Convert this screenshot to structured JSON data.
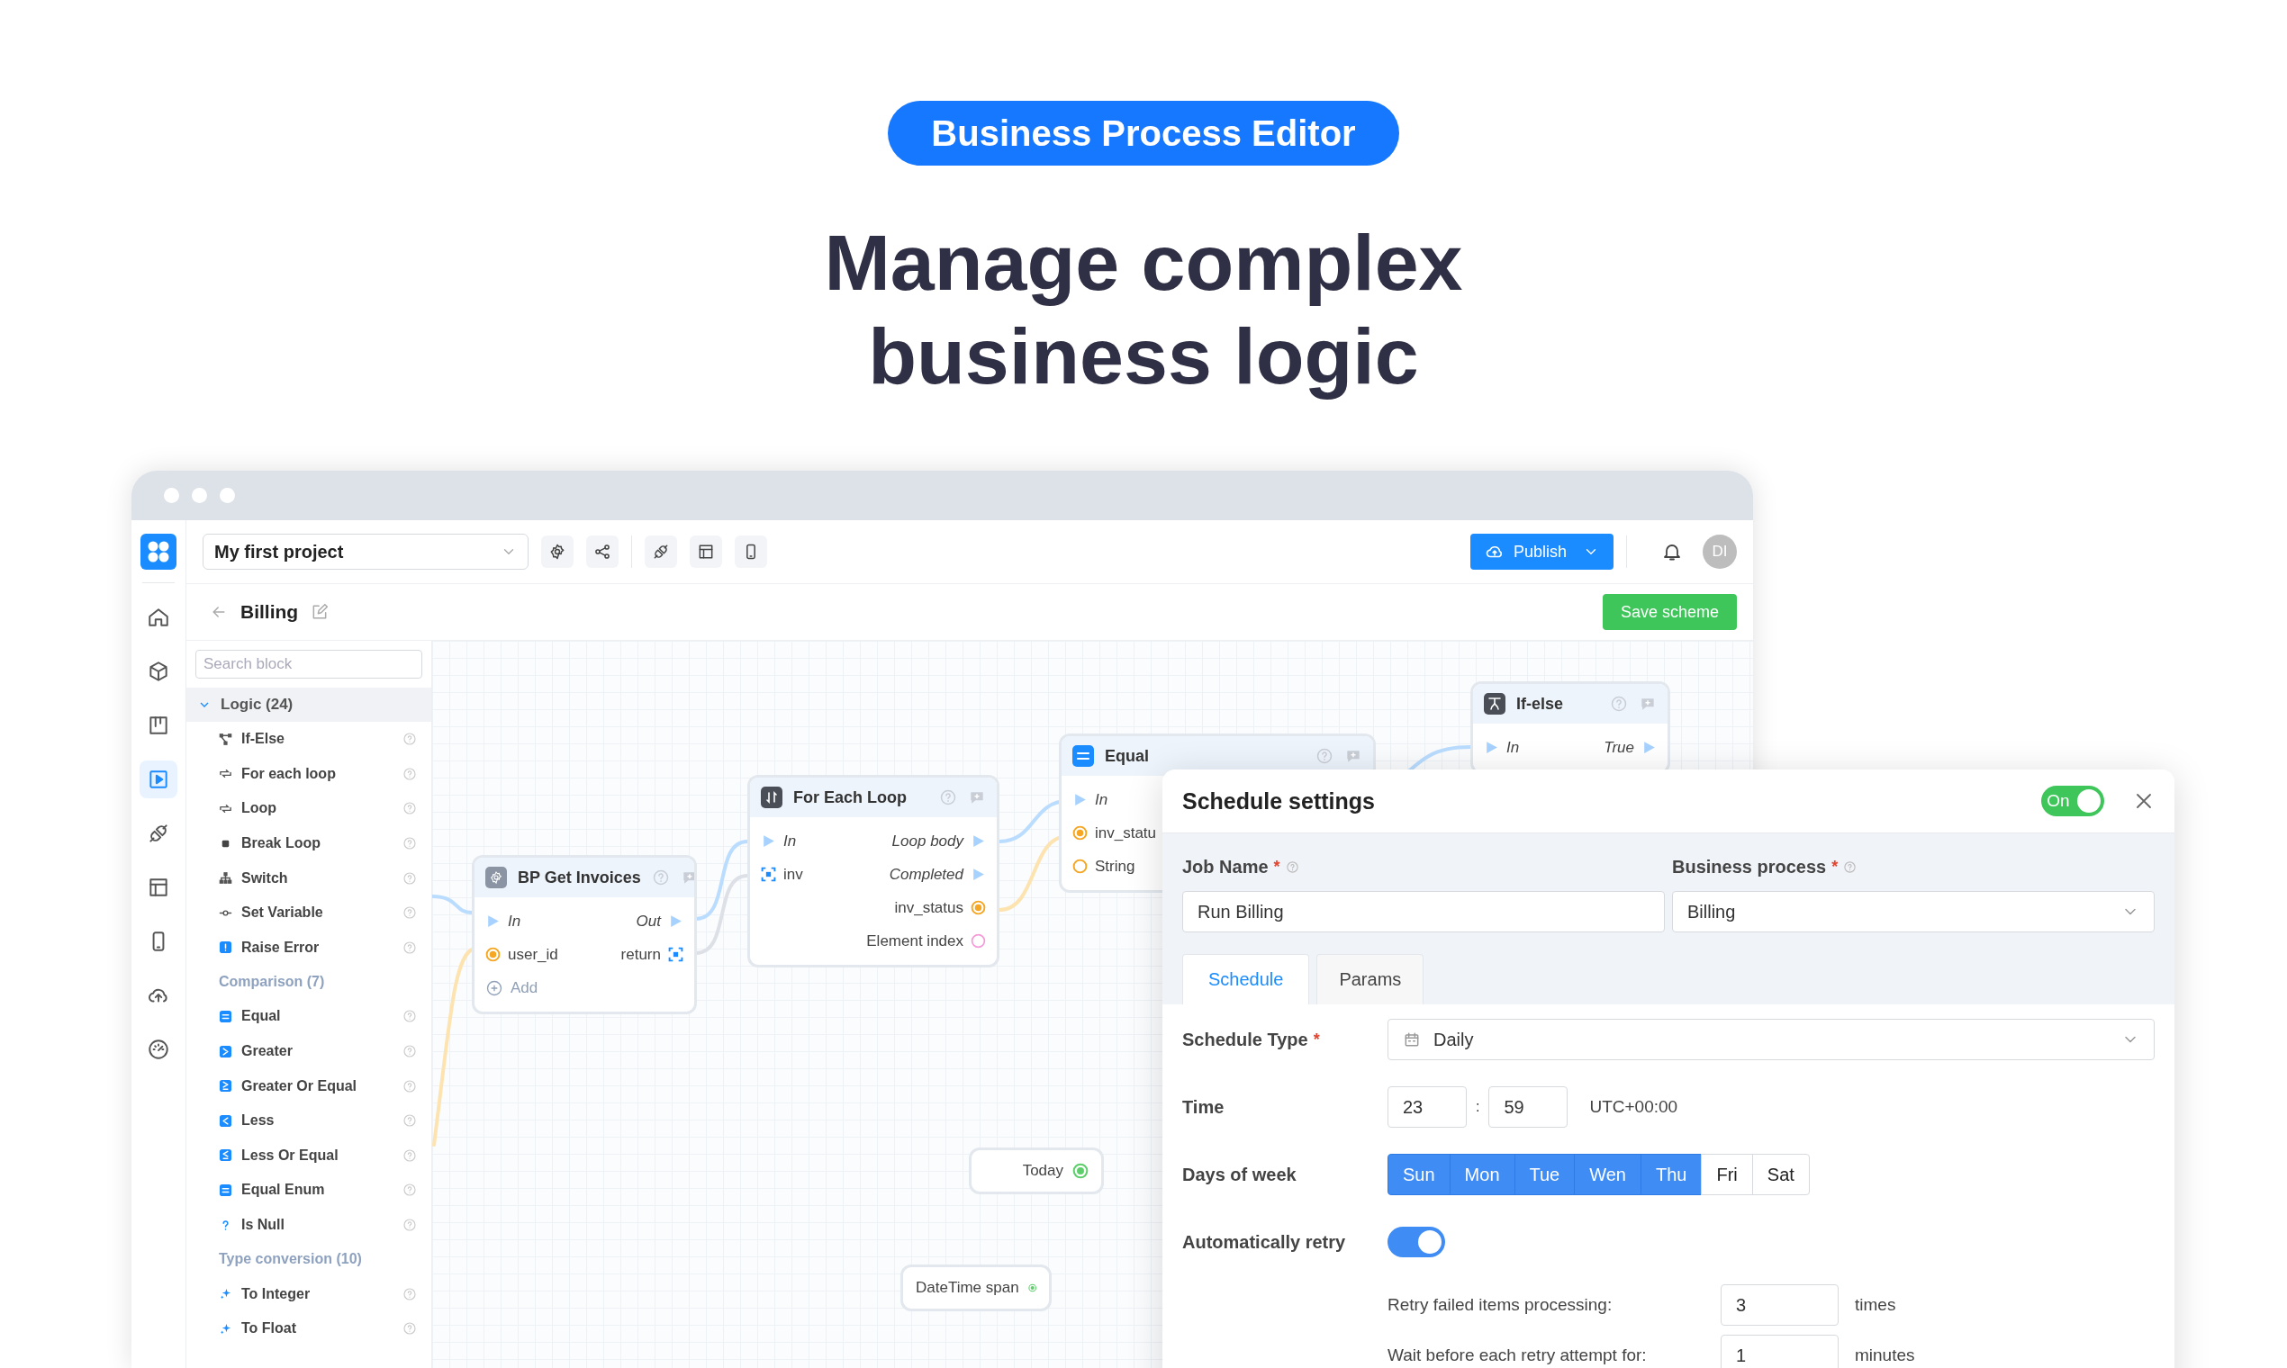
{
  "badge": "Business Process Editor",
  "headline": "Manage complex business logic",
  "rail": [
    {
      "selected": false
    },
    {
      "selected": false
    },
    {
      "selected": false
    },
    {
      "selected": true
    },
    {
      "selected": false
    },
    {
      "selected": false
    },
    {
      "selected": false
    },
    {
      "selected": false
    },
    {
      "selected": false
    }
  ],
  "project": {
    "value": "My first project"
  },
  "publish": "Publish",
  "avatar": "DI",
  "page_title": "Billing",
  "save": "Save scheme",
  "sidebar": {
    "search": {
      "placeholder": "Search block"
    },
    "groups": [
      {
        "kind": "category",
        "title": "Logic (24)",
        "expanded": true,
        "items": [
          "If-Else",
          "For each loop",
          "Loop",
          "Break Loop",
          "Switch",
          "Set Variable",
          "Raise Error"
        ]
      },
      {
        "kind": "section",
        "title": "Comparison (7)",
        "items": [
          "Equal",
          "Greater",
          "Greater Or Equal",
          "Less",
          "Less Or Equal",
          "Equal Enum",
          "Is Null"
        ]
      },
      {
        "kind": "section",
        "title": "Type conversion (10)",
        "items": [
          "To Integer",
          "To Float"
        ]
      }
    ]
  },
  "canvas": {
    "nodes": [
      {
        "kind": "block",
        "title": "BP Get Invoices",
        "rows": [
          {
            "left": {
              "label": "In",
              "kind": "exec"
            },
            "right": {
              "label": "Out",
              "kind": "exec"
            }
          },
          {
            "left": {
              "label": "user_id",
              "kind": "value"
            },
            "right": {
              "label": "return",
              "kind": "list"
            }
          }
        ],
        "add": "Add"
      },
      {
        "kind": "block",
        "title": "For Each Loop",
        "rows": [
          {
            "left": {
              "label": "In",
              "kind": "exec"
            },
            "right": {
              "label": "Loop body",
              "kind": "exec"
            }
          },
          {
            "left": {
              "label": "inv",
              "kind": "list"
            },
            "right": {
              "label": "Completed",
              "kind": "exec"
            }
          },
          {
            "right": {
              "label": "inv_status",
              "kind": "value"
            }
          },
          {
            "right": {
              "label": "Element index",
              "kind": "index"
            }
          }
        ]
      },
      {
        "kind": "block",
        "title": "Equal",
        "rows": [
          {
            "left": {
              "label": "In",
              "kind": "exec"
            }
          },
          {
            "left": {
              "label": "inv_statu",
              "kind": "value"
            }
          },
          {
            "left": {
              "label": "String",
              "kind": "empty"
            }
          }
        ]
      },
      {
        "kind": "block",
        "title": "If-else",
        "rows": [
          {
            "left": {
              "label": "In",
              "kind": "exec"
            },
            "right": {
              "label": "True",
              "kind": "exec"
            }
          }
        ]
      },
      {
        "kind": "pill",
        "title": "Today"
      },
      {
        "kind": "pill",
        "title": "DateTime span"
      }
    ]
  },
  "dialog": {
    "title": "Schedule settings",
    "toggle": {
      "label": "On",
      "on": true
    },
    "job_name": {
      "label": "Job Name",
      "required_mark": "*",
      "value": "Run Billing"
    },
    "business_process": {
      "label": "Business process",
      "required_mark": "*",
      "value": "Billing"
    },
    "tabs": [
      {
        "label": "Schedule",
        "selected": true
      },
      {
        "label": "Params",
        "selected": false
      }
    ],
    "schedule_type": {
      "label": "Schedule Type",
      "required_mark": "*",
      "value": "Daily"
    },
    "time": {
      "label": "Time",
      "hours": "23",
      "separator": ":",
      "minutes": "59",
      "zone": "UTC+00:00"
    },
    "days_label": "Days of week",
    "days": [
      {
        "label": "Sun",
        "selected": true
      },
      {
        "label": "Mon",
        "selected": true
      },
      {
        "label": "Tue",
        "selected": true
      },
      {
        "label": "Wen",
        "selected": true
      },
      {
        "label": "Thu",
        "selected": true
      },
      {
        "label": "Fri",
        "selected": false
      },
      {
        "label": "Sat",
        "selected": false
      }
    ],
    "auto_retry": {
      "label": "Automatically retry",
      "on": true
    },
    "retry_rows": [
      {
        "label": "Retry failed items processing:",
        "value": "3",
        "unit": "times"
      },
      {
        "label": "Wait before each retry attempt for:",
        "value": "1",
        "unit": "minutes"
      }
    ]
  }
}
